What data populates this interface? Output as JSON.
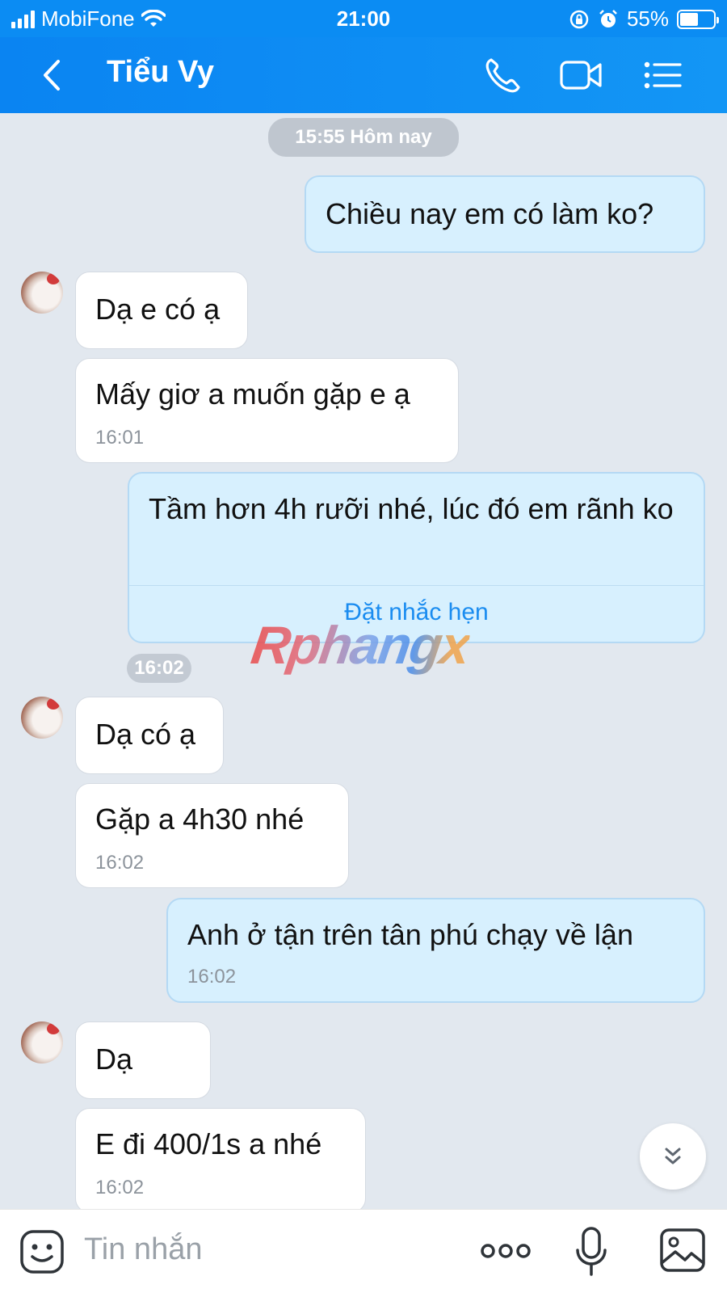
{
  "status_bar": {
    "carrier": "MobiFone",
    "time": "21:00",
    "battery": "55%",
    "battery_level": 0.55
  },
  "header": {
    "title": "Tiểu Vy"
  },
  "chat": {
    "date_label": "15:55 Hôm nay",
    "messages": [
      {
        "dir": "out",
        "text": "Chiều nay em có làm ko?"
      },
      {
        "dir": "in",
        "text": "Dạ e có ạ"
      },
      {
        "dir": "in",
        "text": "Mấy giơ a muốn gặp e ạ",
        "time": "16:01"
      },
      {
        "dir": "out",
        "text": "Tầm hơn 4h rưỡi nhé, lúc đó em rãnh ko",
        "action": "Đặt nhắc hẹn",
        "time": "16:02"
      },
      {
        "dir": "in",
        "text": "Dạ có ạ"
      },
      {
        "dir": "in",
        "text": "Gặp a 4h30 nhé",
        "time": "16:02"
      },
      {
        "dir": "out",
        "text": "Anh ở tận trên tân phú chạy về lận",
        "time": "16:02"
      },
      {
        "dir": "in",
        "text": "Dạ"
      },
      {
        "dir": "in",
        "text": "E đi 400/1s a nhé",
        "time": "16:02"
      }
    ]
  },
  "watermark": "Rphangx",
  "input": {
    "placeholder": "Tin nhắn"
  },
  "icons": [
    "signal-icon",
    "wifi-icon",
    "rotation-lock-icon",
    "alarm-icon",
    "battery-icon",
    "back-icon",
    "phone-icon",
    "video-icon",
    "menu-icon",
    "scroll-down-icon",
    "emoji-icon",
    "more-icon",
    "mic-icon",
    "image-icon"
  ],
  "colors": {
    "header": "#0b8cf3",
    "chat_bg": "#e2e8ef",
    "outgoing_bubble": "#d7f0fe",
    "incoming_bubble": "#ffffff",
    "link": "#1a8cf0"
  }
}
